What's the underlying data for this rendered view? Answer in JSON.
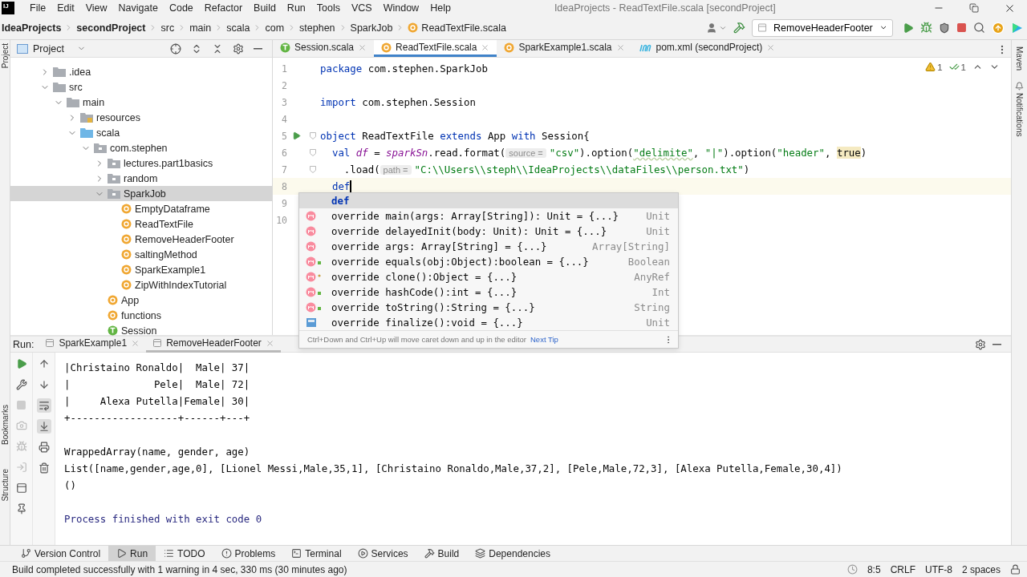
{
  "app_logo": "IJ",
  "menu": [
    "File",
    "Edit",
    "View",
    "Navigate",
    "Code",
    "Refactor",
    "Build",
    "Run",
    "Tools",
    "VCS",
    "Window",
    "Help"
  ],
  "window": {
    "title": "IdeaProjects - ReadTextFile.scala [secondProject]"
  },
  "breadcrumbs": [
    {
      "label": "IdeaProjects",
      "kind": "root"
    },
    {
      "label": "secondProject",
      "kind": "root"
    },
    {
      "label": "src",
      "kind": "dir"
    },
    {
      "label": "main",
      "kind": "dir"
    },
    {
      "label": "scala",
      "kind": "dir"
    },
    {
      "label": "com",
      "kind": "dir"
    },
    {
      "label": "stephen",
      "kind": "dir"
    },
    {
      "label": "SparkJob",
      "kind": "dir"
    },
    {
      "label": "ReadTextFile.scala",
      "kind": "file"
    }
  ],
  "run_config": "RemoveHeaderFooter",
  "left_strip": [
    "Project",
    "Bookmarks",
    "Structure"
  ],
  "right_strip": [
    "Maven",
    "Notifications"
  ],
  "project_panel": {
    "title": "Project",
    "tree": [
      {
        "label": ".idea",
        "kind": "folder",
        "expanded": false,
        "selected": false
      },
      {
        "label": "src",
        "kind": "folder",
        "expanded": true,
        "selected": false,
        "children": [
          {
            "label": "main",
            "kind": "folder",
            "expanded": true,
            "selected": false,
            "children": [
              {
                "label": "resources",
                "kind": "resources",
                "expanded": false,
                "selected": false
              },
              {
                "label": "scala",
                "kind": "source",
                "expanded": true,
                "selected": false,
                "children": [
                  {
                    "label": "com.stephen",
                    "kind": "package",
                    "expanded": true,
                    "selected": false,
                    "children": [
                      {
                        "label": "lectures.part1basics",
                        "kind": "package",
                        "expanded": false,
                        "selected": false
                      },
                      {
                        "label": "random",
                        "kind": "package",
                        "expanded": false,
                        "selected": false
                      },
                      {
                        "label": "SparkJob",
                        "kind": "package",
                        "expanded": true,
                        "selected": true,
                        "children": [
                          {
                            "label": "EmptyDataframe",
                            "kind": "object",
                            "selected": false
                          },
                          {
                            "label": "ReadTextFile",
                            "kind": "object",
                            "selected": false
                          },
                          {
                            "label": "RemoveHeaderFooter",
                            "kind": "object",
                            "selected": false
                          },
                          {
                            "label": "saltingMethod",
                            "kind": "object",
                            "selected": false
                          },
                          {
                            "label": "SparkExample1",
                            "kind": "object",
                            "selected": false
                          },
                          {
                            "label": "ZipWithIndexTutorial",
                            "kind": "object",
                            "selected": false
                          }
                        ]
                      },
                      {
                        "label": "App",
                        "kind": "object",
                        "selected": false
                      },
                      {
                        "label": "functions",
                        "kind": "object",
                        "selected": false
                      },
                      {
                        "label": "Session",
                        "kind": "trait",
                        "selected": false
                      }
                    ]
                  }
                ]
              }
            ]
          }
        ]
      }
    ]
  },
  "editor_tabs": [
    {
      "label": "Session.scala",
      "kind": "trait",
      "selected": false
    },
    {
      "label": "ReadTextFile.scala",
      "kind": "object",
      "selected": true
    },
    {
      "label": "SparkExample1.scala",
      "kind": "object",
      "selected": false
    },
    {
      "label": "pom.xml (secondProject)",
      "kind": "maven",
      "selected": false
    }
  ],
  "editor": {
    "warnings": "1",
    "checks": "1",
    "lines": [
      {
        "number": "1",
        "tokens": [
          {
            "text": "package",
            "kind": "kw"
          },
          {
            "text": " com.stephen.SparkJob",
            "kind": "plain"
          }
        ]
      },
      {
        "number": "2"
      },
      {
        "number": "3",
        "tokens": [
          {
            "text": "import",
            "kind": "kw"
          },
          {
            "text": " com.stephen.Session",
            "kind": "plain"
          }
        ]
      },
      {
        "number": "4"
      },
      {
        "number": "5",
        "run": true,
        "fold": true,
        "tokens": [
          {
            "text": "object",
            "kind": "kw"
          },
          {
            "text": " ReadTextFile ",
            "kind": "plain"
          },
          {
            "text": "extends",
            "kind": "kw"
          },
          {
            "text": " App ",
            "kind": "plain"
          },
          {
            "text": "with",
            "kind": "kw"
          },
          {
            "text": " Session{",
            "kind": "plain"
          }
        ]
      },
      {
        "number": "6",
        "fold": true,
        "tokens": [
          {
            "text": "  val",
            "kind": "kw"
          },
          {
            "text": " df",
            "kind": "var"
          },
          {
            "text": " = ",
            "kind": "plain"
          },
          {
            "text": "sparkSn",
            "kind": "var"
          },
          {
            "text": ".read.format(",
            "kind": "plain"
          },
          {
            "text": "source =",
            "kind": "hint"
          },
          {
            "text": "\"csv\"",
            "kind": "str"
          },
          {
            "text": ").option(",
            "kind": "plain"
          },
          {
            "text": "\"delimite\"",
            "kind": "typo"
          },
          {
            "text": ", ",
            "kind": "plain"
          },
          {
            "text": "\"|\"",
            "kind": "str"
          },
          {
            "text": ").option(",
            "kind": "plain"
          },
          {
            "text": "\"header\"",
            "kind": "str"
          },
          {
            "text": ", ",
            "kind": "plain"
          },
          {
            "text": "true",
            "kind": "marked"
          },
          {
            "text": ")",
            "kind": "plain"
          }
        ]
      },
      {
        "number": "7",
        "fold": true,
        "tokens": [
          {
            "text": "    .load(",
            "kind": "plain"
          },
          {
            "text": "path =",
            "kind": "hint"
          },
          {
            "text": "\"C:\\\\Users\\\\steph\\\\IdeaProjects\\\\dataFiles\\\\person.txt\"",
            "kind": "str"
          },
          {
            "text": ")",
            "kind": "plain"
          }
        ]
      },
      {
        "number": "8",
        "current": true,
        "tokens": [
          {
            "text": "  def",
            "kind": "kw"
          }
        ]
      },
      {
        "number": "9"
      },
      {
        "number": "10"
      }
    ]
  },
  "completion": {
    "items": [
      {
        "text": "def",
        "kind": "keyword",
        "selected": true
      },
      {
        "text": "override main(args: Array[String]): Unit = {...}",
        "type": "Unit",
        "kind": "method",
        "selected": false
      },
      {
        "text": "override delayedInit(body: Unit): Unit = {...}",
        "type": "Unit",
        "kind": "method",
        "selected": false
      },
      {
        "text": "override args: Array[String] = {...}",
        "type": "Array[String]",
        "kind": "method",
        "selected": false
      },
      {
        "text": "override equals(obj:Object):boolean = {...}",
        "type": "Boolean",
        "kind": "public-method",
        "selected": false
      },
      {
        "text": "override clone():Object = {...}",
        "type": "AnyRef",
        "kind": "protected-method",
        "selected": false
      },
      {
        "text": "override hashCode():int = {...}",
        "type": "Int",
        "kind": "public-method",
        "selected": false
      },
      {
        "text": "override toString():String = {...}",
        "type": "String",
        "kind": "public-method",
        "selected": false
      },
      {
        "text": "override finalize():void = {...}",
        "type": "Unit",
        "kind": "class-file",
        "selected": false
      }
    ],
    "hint": "Ctrl+Down and Ctrl+Up will move caret down and up in the editor",
    "link": "Next Tip"
  },
  "run_panel": {
    "label": "Run:",
    "tabs": [
      {
        "label": "SparkExample1",
        "selected": false
      },
      {
        "label": "RemoveHeaderFooter",
        "selected": true
      }
    ],
    "soft_wrap": true,
    "scroll_to_end": true,
    "console": [
      [
        {
          "text": "|Christaino Ronaldo|  Male| 37|",
          "kind": "output"
        },
        {
          "text": "|              Pele|  Male| 72|",
          "kind": "output"
        },
        {
          "text": "|     Alexa Putella|Female| 30|",
          "kind": "output"
        },
        {
          "text": "+------------------+------+---+",
          "kind": "output"
        }
      ],
      [
        {
          "text": "WrappedArray(name, gender, age)",
          "kind": "output"
        },
        {
          "text": "List([name,gender,age,0], [Lionel Messi,Male,35,1], [Christaino Ronaldo,Male,37,2], [Pele,Male,72,3], [Alexa Putella,Female,30,4])",
          "kind": "output"
        },
        {
          "text": "()",
          "kind": "output"
        }
      ],
      [
        {
          "text": "Process finished with exit code 0",
          "kind": "system"
        }
      ]
    ]
  },
  "tool_tabs": [
    {
      "label": "Version Control",
      "kind": "vcs",
      "selected": false
    },
    {
      "label": "Run",
      "kind": "run",
      "selected": true
    },
    {
      "label": "TODO",
      "kind": "todo",
      "selected": false
    },
    {
      "label": "Problems",
      "kind": "problems",
      "selected": false
    },
    {
      "label": "Terminal",
      "kind": "terminal",
      "selected": false
    },
    {
      "label": "Services",
      "kind": "services",
      "selected": false
    },
    {
      "label": "Build",
      "kind": "build",
      "selected": false
    },
    {
      "label": "Dependencies",
      "kind": "dependencies",
      "selected": false
    }
  ],
  "status_bar": {
    "message": "Build completed successfully with 1 warning in 4 sec, 330 ms (30 minutes ago)",
    "position": "8:5",
    "line_separator": "CRLF",
    "encoding": "UTF-8",
    "indent": "2 spaces"
  }
}
